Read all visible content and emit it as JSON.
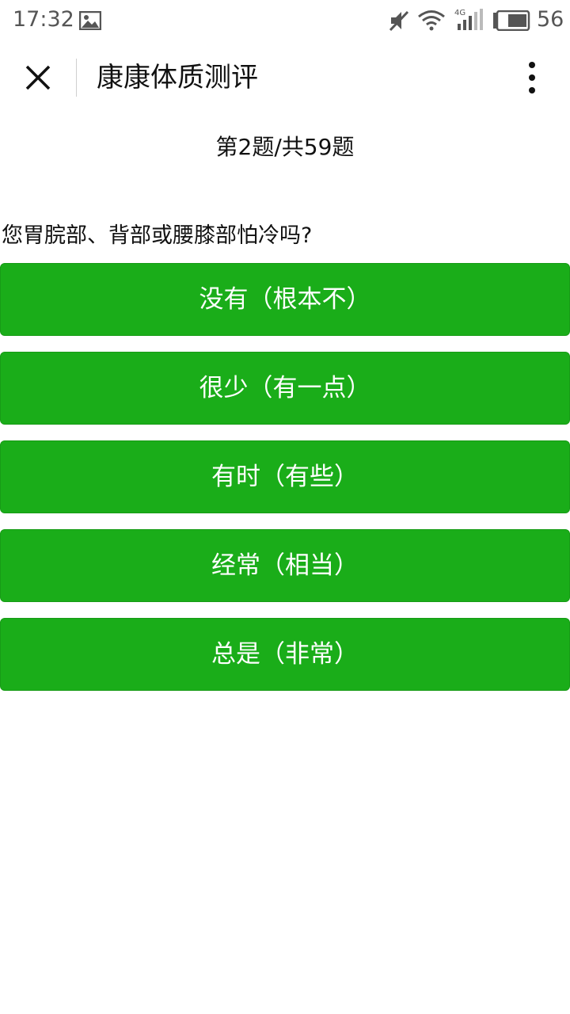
{
  "status_bar": {
    "time": "17:32",
    "battery_level": "56",
    "icons": [
      "image-icon",
      "mute-icon",
      "wifi-icon",
      "signal-4g-icon",
      "battery-icon"
    ]
  },
  "nav": {
    "title": "康康体质测评",
    "icons": [
      "close-icon",
      "more-vertical-icon"
    ]
  },
  "progress": {
    "text": "第2题/共59题"
  },
  "question": {
    "text": "您胃脘部、背部或腰膝部怕冷吗?"
  },
  "options": [
    {
      "label": "没有（根本不）"
    },
    {
      "label": "很少（有一点）"
    },
    {
      "label": "有时（有些）"
    },
    {
      "label": "经常（相当）"
    },
    {
      "label": "总是（非常）"
    }
  ],
  "colors": {
    "button_green": "#1aad19",
    "button_text": "#ffffff"
  }
}
